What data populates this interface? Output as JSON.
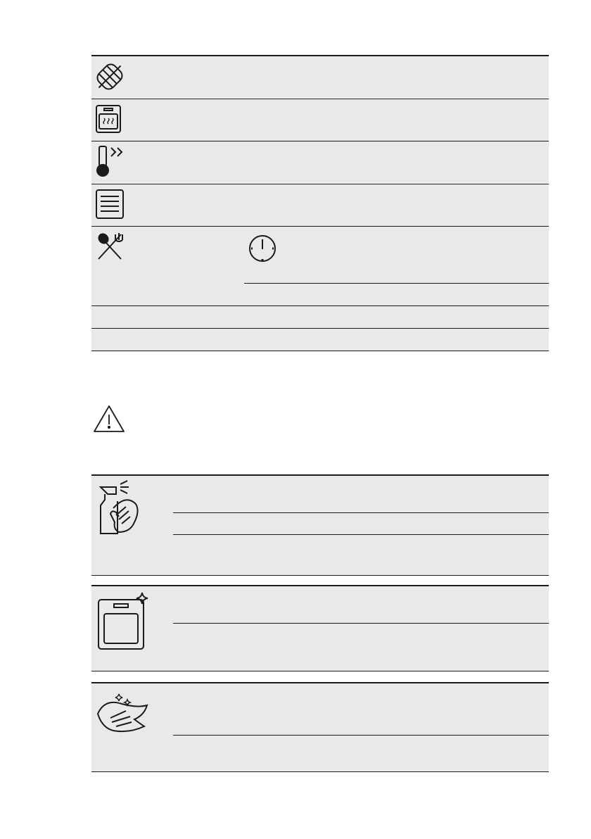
{
  "table_1": {
    "rows": [
      {
        "icon": "rotisserie-spit-icon"
      },
      {
        "icon": "oven-heating-function-icon"
      },
      {
        "icon": "temperature-increase-icon"
      },
      {
        "icon": "recipe-menu-icon"
      },
      {
        "icon": "cutlery-icon",
        "sub_icon": "clock-icon"
      }
    ]
  },
  "warning": {
    "icon": "warning-triangle-icon"
  },
  "table_2": {
    "rows": [
      {
        "icon": "spray-and-wipe-icon"
      },
      {
        "icon": "clean-oven-sparkle-icon"
      },
      {
        "icon": "wipe-cloth-sparkle-icon"
      }
    ]
  },
  "colors": {
    "band": "#e9e9e9",
    "line": "#1a1a1a"
  }
}
